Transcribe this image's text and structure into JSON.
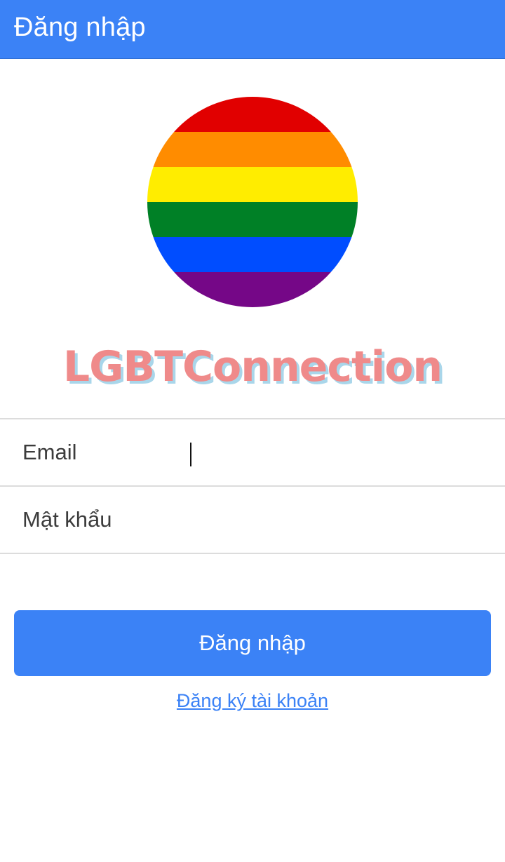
{
  "header": {
    "title": "Đăng nhập"
  },
  "logo": {
    "icon": "rainbow-flag-circle",
    "stripes": [
      "#e10000",
      "#ff8c00",
      "#ffed00",
      "#008026",
      "#004dff",
      "#750787"
    ]
  },
  "brand": {
    "name": "LGBTConnection",
    "color": "#ef8a8a",
    "shadow_color": "#a9d6ea"
  },
  "form": {
    "email": {
      "label": "Email",
      "value": "",
      "placeholder": ""
    },
    "password": {
      "label": "Mật khẩu",
      "value": "",
      "placeholder": ""
    }
  },
  "actions": {
    "login_label": "Đăng nhập",
    "register_label": "Đăng ký tài khoản"
  },
  "colors": {
    "accent": "#3b82f6"
  }
}
